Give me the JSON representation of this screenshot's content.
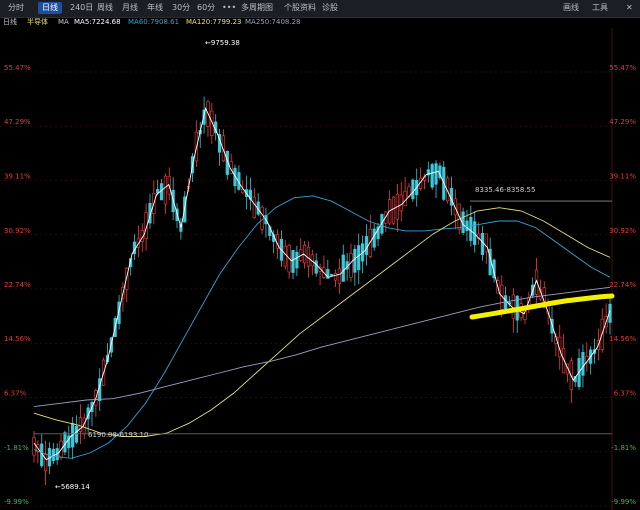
{
  "toolbar": {
    "tabs": [
      {
        "label": "分时",
        "active": false
      },
      {
        "label": "日线",
        "active": true
      },
      {
        "label": "240日",
        "active": false
      },
      {
        "label": "周线",
        "active": false
      },
      {
        "label": "月线",
        "active": false
      },
      {
        "label": "年线",
        "active": false
      },
      {
        "label": "30分",
        "active": false
      },
      {
        "label": "60分",
        "active": false
      },
      {
        "label": "•••",
        "active": false
      },
      {
        "label": "多周期图",
        "active": false
      },
      {
        "label": "个股资料",
        "active": false
      },
      {
        "label": "诊股",
        "active": false
      }
    ],
    "right_items": [
      "画线",
      "工具"
    ]
  },
  "legend": {
    "period": "日线",
    "name": "半导体",
    "ma_label": "MA",
    "ma5": "MA5:7224.68",
    "ma60": "MA60:7908.61",
    "ma120": "MA120:7799.23",
    "ma250": "MA250:7408.28",
    "colors": {
      "ma5": "#ffffff",
      "ma60": "#2fa6d6",
      "ma120": "#e8e07a",
      "ma250": "#9aa0c8"
    }
  },
  "annotations": {
    "high": "←9759.38",
    "low": "←5689.14",
    "resist": "8335.46-8358.55",
    "support": "6190.08-6193.10"
  },
  "chart_data": {
    "type": "line",
    "title": "",
    "xlabel": "",
    "ylabel": "",
    "y_axis_ticks_left": [
      "55.47%",
      "47.29%",
      "39.11%",
      "30.92%",
      "22.74%",
      "14.56%",
      "6.37%",
      "-1.81%",
      "-9.99%"
    ],
    "y_axis_ticks_right": [
      "55.47%",
      "47.29%",
      "39.11%",
      "30.92%",
      "22.74%",
      "14.56%",
      "6.37%",
      "-1.81%",
      "-9.99%"
    ],
    "ylim_percent": [
      -9.99,
      58
    ],
    "levels_percent": {
      "high": 58.2,
      "low": -5.3,
      "resist": 36.0,
      "support": 0.9
    },
    "series": [
      {
        "name": "MA5",
        "color": "#ffffff",
        "values": [
          -0.5,
          -3.0,
          -2.0,
          0.5,
          2.0,
          6.0,
          12.0,
          20.0,
          28.0,
          31.0,
          37.0,
          38.5,
          32.0,
          42.0,
          50.0,
          46.0,
          41.0,
          38.0,
          35.5,
          33.0,
          29.0,
          27.0,
          28.0,
          26.5,
          24.5,
          25.0,
          27.0,
          28.5,
          31.5,
          34.5,
          35.5,
          37.5,
          40.0,
          40.5,
          36.5,
          32.5,
          31.0,
          29.0,
          22.0,
          20.0,
          19.0,
          24.0,
          19.0,
          13.0,
          9.0,
          11.5,
          14.0,
          19.5
        ]
      },
      {
        "name": "MA60",
        "color": "#2fa6d6",
        "values": [
          -1.5,
          -2.5,
          -2.8,
          -2.0,
          -0.5,
          2.0,
          5.5,
          10.0,
          15.0,
          20.0,
          25.0,
          29.0,
          32.5,
          35.0,
          36.5,
          36.8,
          36.0,
          34.5,
          33.0,
          32.0,
          31.5,
          31.5,
          31.8,
          32.0,
          32.5,
          33.0,
          33.0,
          32.0,
          30.0,
          28.0,
          26.0,
          24.5
        ]
      },
      {
        "name": "MA120",
        "color": "#e8e07a",
        "values": [
          4.0,
          3.0,
          2.2,
          1.0,
          0.5,
          0.5,
          1.0,
          2.5,
          4.5,
          7.0,
          10.0,
          13.0,
          16.0,
          18.5,
          21.0,
          23.5,
          26.0,
          28.5,
          31.0,
          33.0,
          34.5,
          35.0,
          34.5,
          33.0,
          31.0,
          29.0,
          27.5
        ]
      },
      {
        "name": "MA250",
        "color": "#9aa0c8",
        "values": [
          5.0,
          5.5,
          6.0,
          6.2,
          7.0,
          8.0,
          9.0,
          10.0,
          11.0,
          11.8,
          12.8,
          14.0,
          15.0,
          16.0,
          17.0,
          18.0,
          19.0,
          20.0,
          20.8,
          21.5,
          22.0,
          22.5,
          23.0
        ]
      }
    ],
    "grid": true,
    "legend_position": "top-left"
  }
}
